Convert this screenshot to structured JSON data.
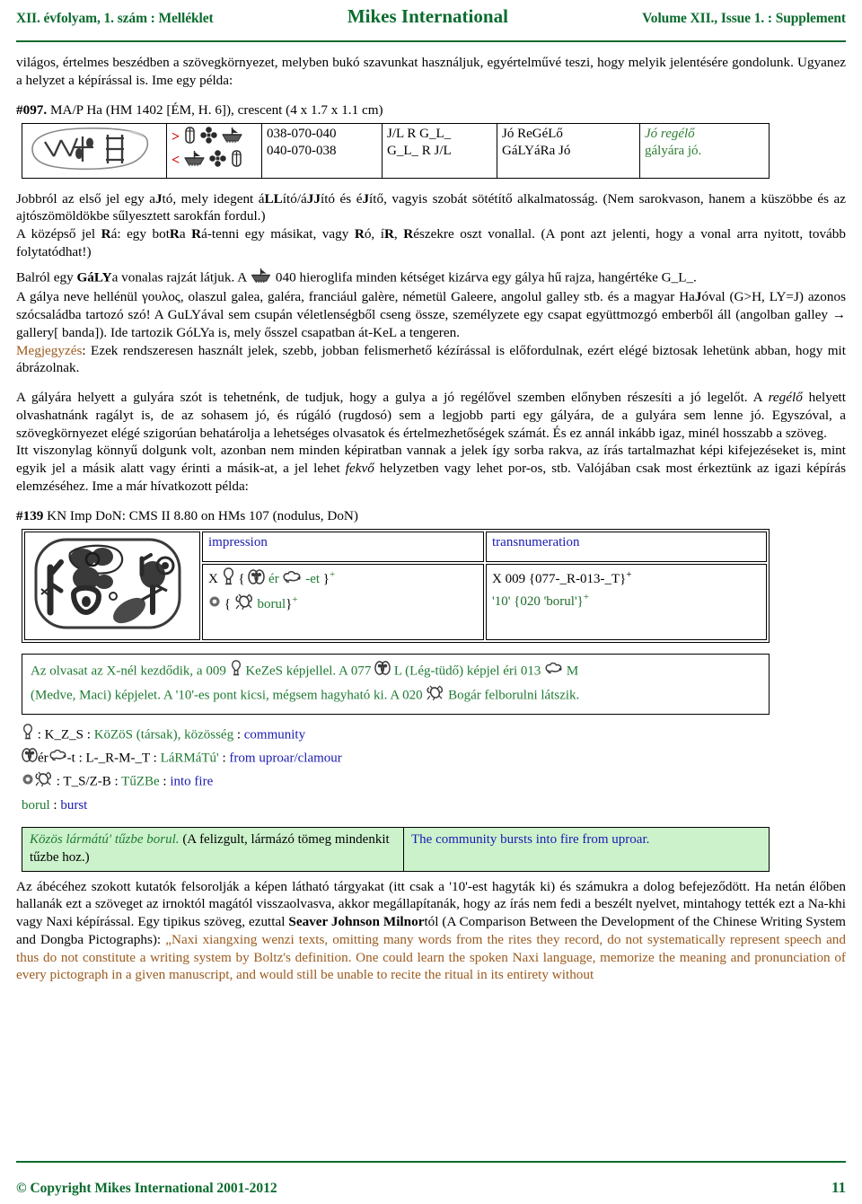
{
  "header": {
    "left": "XII. évfolyam, 1. szám : Melléklet",
    "center": "Mikes International",
    "right": "Volume XII., Issue 1. : Supplement",
    "color": "#0a6b2e"
  },
  "intro": {
    "p1": "világos, értelmes beszédben a szövegkörnyezet, melyben bukó szavunkat használjuk, egyértelművé teszi, hogy melyik jelentésére gondolunk. Ugyanez a helyzet a képírással is. Ime egy példa:",
    "ref_bold": "#097.",
    "ref_rest": " MA/P Ha (HM 1402 [ÉM, H. 6]), crescent (4 x 1.7 x 1.1 cm)"
  },
  "table1": {
    "arrow_forward": ">",
    "arrow_back": "<",
    "arrow_color": "#cc0000",
    "glyphs_top": [
      "door-glyph",
      "cross-glyph",
      "boat-glyph"
    ],
    "glyphs_bottom": [
      "boat-glyph",
      "cross-glyph",
      "door-glyph"
    ],
    "numbers": [
      "038-070-040",
      "040-070-038"
    ],
    "translit": [
      "J/L R G_L_",
      "G_L_ R J/L"
    ],
    "hungarian": [
      "Jó ReGéLő",
      "GáLYáRa Jó"
    ],
    "reading": [
      "Jó regélő",
      "gályára jó."
    ],
    "reading_color": "#2e7d32"
  },
  "body": {
    "p2_a": "Jobbról az első jel egy a",
    "p2_J": "J",
    "p2_b": "tó, mely idegent á",
    "p2_LL": "LL",
    "p2_c": "ító/á",
    "p2_JJ": "JJ",
    "p2_d": "ító és é",
    "p2_J2": "J",
    "p2_e": "ítő, vagyis szobát sötétítő alkalmatosság. (Nem sarokvason, hanem a küszöbbe és az ajtószömöldökbe sűlyesztett sarokfán fordul.)",
    "p3_a": "A középső jel ",
    "p3_R1": "R",
    "p3_b": "á: egy bot",
    "p3_R2": "R",
    "p3_c": "a ",
    "p3_R3": "R",
    "p3_d": "á-tenni egy másikat, vagy ",
    "p3_R4": "R",
    "p3_e": "ó, í",
    "p3_R5": "R",
    "p3_f": ", ",
    "p3_R6": "R",
    "p3_g": "észekre oszt vonallal. (A pont azt jelenti, hogy a vonal arra nyitott, tovább folytatódhat!)",
    "p4_a": "Balról egy ",
    "p4_GALY": "GáLY",
    "p4_b": "a vonalas rajzát látjuk. A ",
    "p4_boat": "boat-glyph",
    "p4_c": " 040 hieroglifa minden kétséget kizárva egy gálya hű rajza, hangértéke G_L_.",
    "p5": "A gálya neve hellénül γουλος, olaszul galea, galéra, franciául galère, németül Galeere, angolul galley stb. és a magyar Ha",
    "p5_J": "J",
    "p5_b": "óval (G>H, LY=J) azonos szócsaládba tartozó szó! A GuLYával sem csupán véletlenségből cseng össze, személyzete egy csapat együttmozgó emberből áll (angolban galley ",
    "p5_arrow": "→",
    "p5_c": " gallery[ banda]). Ide tartozik GóLYa is, mely ősszel csapatban át-KeL a tengeren.",
    "p6_label": "Megjegyzés",
    "p6_label_color": "#9b5a1e",
    "p6_rest": ": Ezek rendszeresen használt jelek, szebb, jobban felismerhető kézírással is előfordulnak, ezért elégé biztosak lehetünk abban, hogy mit ábrázolnak.",
    "p7_a": "A gályára helyett a gulyára szót is tehetnénk, de tudjuk, hogy a gulya a jó regélővel szemben előnyben részesíti a jó legelőt. A ",
    "p7_i1": "regélő",
    "p7_b": " helyett olvashatnánk ragályt is, de az sohasem jó, és rúgáló (rugdosó) sem a legjobb parti egy gályára, de a gulyára sem lenne jó. Egyszóval, a szövegkörnyezet elégé szigorúan behatárolja a lehetséges olvasatok és értelmezhetőségek számát. És ez annál inkább igaz, minél hosszabb a szöveg.",
    "p8_a": "Itt viszonylag könnyű dolgunk volt, azonban nem minden képiratban vannak a jelek így sorba rakva, az írás tartalmazhat képi kifejezéseket is, mint egyik jel a másik alatt vagy érinti a másik-at, a jel lehet ",
    "p8_i1": "fekvő",
    "p8_b": " helyzetben vagy lehet por-os, stb. Valójában csak most érkeztünk az igazi képírás elemzéséhez. Ime a már hívatkozott példa:"
  },
  "ref2": {
    "bold": "#139",
    "rest": " KN Imp DoN: CMS II 8.80 on HMs 107 (nodulus, DoN)"
  },
  "table2": {
    "head_impression": "impression",
    "head_transnumeration": "transnumeration",
    "head_color": "#1a1ab0",
    "impression_line1": {
      "x": "X",
      "glyph1": "kezes-glyph",
      "brace_open": "{",
      "glyph2": "lungs-glyph",
      "er": "ér",
      "glyph3": "bear-glyph",
      "et": "-et",
      "brace_close": "}",
      "plus": "+"
    },
    "impression_line2": {
      "glyph1": "dot-glyph",
      "brace_open": "{",
      "glyph2": "beetle-glyph",
      "borul": "borul",
      "brace_close": "}",
      "plus": "+"
    },
    "transnumeration_line1": "X 009 {077-_R-013-_T}",
    "transnumeration_line1_sup": "+",
    "transnumeration_line2": "'10' {020 'borul'}",
    "transnumeration_line2_sup": "+",
    "green": "#1f7a33"
  },
  "notebox": {
    "l1_a": "Az olvasat az X-nél kezdődik, a 009 ",
    "l1_g1": "kezes-glyph",
    "l1_b": " KeZeS képjellel. A 077 ",
    "l1_g2": "lungs-glyph",
    "l1_c": " L (Lég-tüdő) képjel éri 013 ",
    "l1_g3": "bear-glyph",
    "l1_d": " M",
    "l2_a": "(Medve, Maci) képjelet.  A '10'-es pont kicsi, mégsem hagyható ki. A 020 ",
    "l2_g1": "beetle-glyph",
    "l2_b": " Bogár felborulni látszik.",
    "color": "#1f7a33"
  },
  "glossary": [
    {
      "glyphs": [
        "kezes-glyph"
      ],
      "sep1": " : ",
      "translit": "K_Z_S",
      "sep2": " : ",
      "hungarian": "KöZöS (társak), közösség",
      "sep3": " : ",
      "english": "community"
    },
    {
      "glyphs": [
        "lungs-glyph",
        "bear-glyph"
      ],
      "mid1": "ér",
      "mid2": "-t",
      "sep1": " : ",
      "translit": "L-_R-M-_T",
      "sep2": " : ",
      "hungarian": "LáRMáTú'",
      "sep3": " : ",
      "english": "from uproar/clamour"
    },
    {
      "glyphs": [
        "dot-glyph",
        "beetle-glyph"
      ],
      "sep1": " : ",
      "translit": "T_S/Z-B",
      "sep2": " : ",
      "hungarian": "TűZBe",
      "sep3": " : ",
      "english": "into fire"
    },
    {
      "plain_hu": "borul",
      "sep3": " : ",
      "english": "burst"
    }
  ],
  "table3": {
    "hu_italic": "Közös lármátú' tűzbe borul.",
    "hu_rest": " (A felizgult, lármázó tömeg mindenkit tűzbe hoz.)",
    "en": "The community bursts into fire from uproar.",
    "bg": "#ccf2cc",
    "en_color": "#1a1ab0",
    "hu_italic_color": "#1f7a33"
  },
  "closing": {
    "p1_a": "Az ábécéhez szokott kutatók felsorolják a képen látható tárgyakat (itt csak a '10'-est hagyták ki) és számukra a dolog befejeződött. Ha netán élőben hallanák ezt a szöveget az irnoktól magától visszaolvasva, akkor megállapítanák, hogy az írás nem fedi a beszélt nyelvet, mintahogy tették ezt a Na-khi vagy Naxi képírással. Egy tipikus szöveg, ezuttal ",
    "p1_bold": "Seaver Johnson Milnor",
    "p1_b": "tól (A Comparison Between the Development of the Chinese Writing System and Dongba Pictographs): ",
    "quote_open": "„",
    "quote": "Naxi xiangxing wenzi texts, omitting many words from the rites they record, do not systematically represent speech and thus do not constitute a writing system by Boltz's definition. One could learn the spoken Naxi language, memorize the meaning and pronunciation of every pictograph in a given manuscript, and would still be unable to recite the ritual in its entirety without",
    "quote_color": "#9b5a1e"
  },
  "footer": {
    "copyright": "© Copyright Mikes International 2001-2012",
    "page_number": "11",
    "color": "#0a6b2e"
  }
}
